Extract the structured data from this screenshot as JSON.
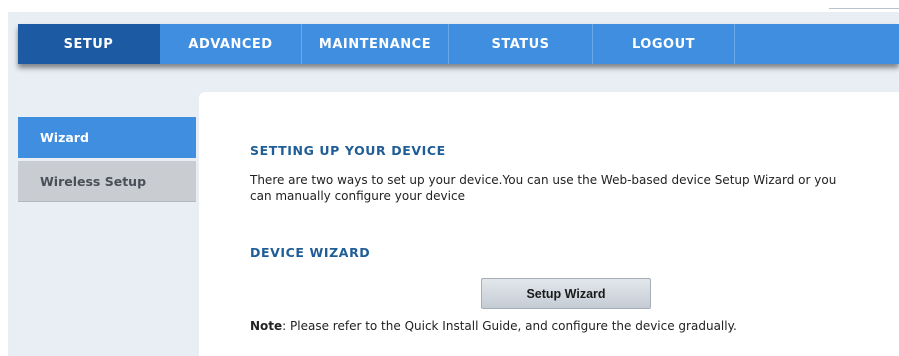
{
  "nav": {
    "tabs": [
      {
        "label": "SETUP",
        "active": true
      },
      {
        "label": "ADVANCED",
        "active": false
      },
      {
        "label": "MAINTENANCE",
        "active": false
      },
      {
        "label": "STATUS",
        "active": false
      },
      {
        "label": "LOGOUT",
        "active": false
      }
    ]
  },
  "sidebar": {
    "items": [
      {
        "label": "Wizard",
        "active": true
      },
      {
        "label": "Wireless Setup",
        "active": false
      }
    ]
  },
  "main": {
    "section1_title": "SETTING UP YOUR DEVICE",
    "description": "There are two ways to set up your device.You can use the Web-based device Setup Wizard or you can manually configure your device",
    "section2_title": "DEVICE WIZARD",
    "wizard_button_label": "Setup Wizard",
    "note_label": "Note",
    "note_text": ": Please refer to the Quick Install Guide, and configure the device gradually."
  },
  "colors": {
    "nav_blue": "#3f8ee0",
    "nav_active": "#1d5aa4",
    "title_blue": "#1f5d96",
    "sidebar_inactive": "#c9ccd1",
    "page_bg": "#e9eef4"
  }
}
